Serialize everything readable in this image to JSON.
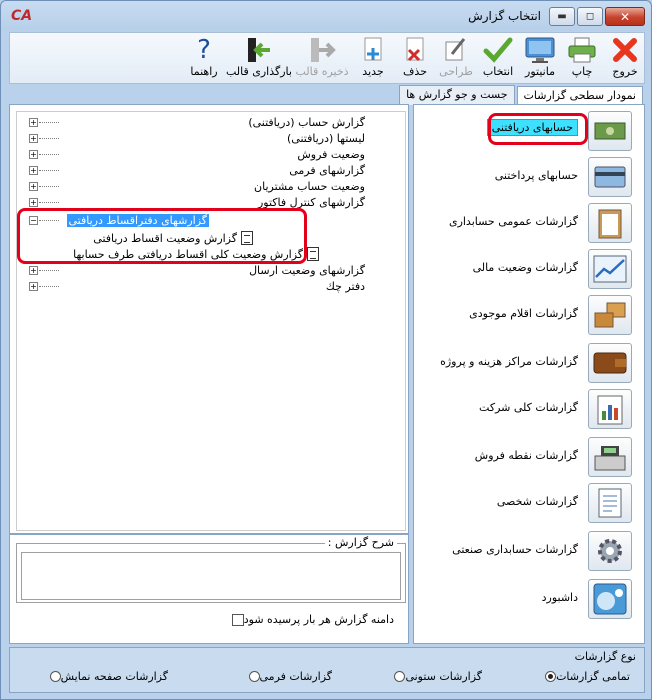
{
  "window": {
    "title": "انتخاب گزارش",
    "logo": "CA",
    "min_glyph": "▬",
    "max_glyph": "◻",
    "close_glyph": "✕",
    "colors": {
      "title_bg": "#b9d1ea",
      "selection": "#3399ff",
      "highlight": "#3de0ff",
      "callout": "#e3001b"
    }
  },
  "toolbar": {
    "exit": "خروج",
    "print": "چاپ",
    "monitor": "مانیتور",
    "select": "انتخاب",
    "design": "طراحی",
    "delete": "حذف",
    "new": "جدید",
    "save_template": "ذخیره قالب",
    "load_template": "بارگذاری قالب",
    "help": "راهنما"
  },
  "tabs": [
    "نمودار سطحی گزارشات",
    "جست و جو گزارش ها"
  ],
  "tree": {
    "nodes": [
      "گزارش حساب (دریافتنی)",
      "لیستها (دریافتنی)",
      "وضعیت فروش",
      "گزارشهای فرمی",
      "وضعیت حساب مشتریان",
      "گزارشهای کنترل فاکتور",
      "گزارشهای دفتراقساط دریافتی",
      "گزارشهای وضعیت ارسال",
      "دفتر چك"
    ],
    "expander_plus": "+",
    "expander_minus": "−",
    "selected_children": [
      "گزارش وضعیت اقساط دریافتی",
      "گزارش وضعیت کلی اقساط دریافتی طرف حسابها"
    ]
  },
  "description": {
    "legend": "شرح گزارش :",
    "checkbox_label": "دامنه گزارش هر بار پرسیده شود"
  },
  "categories": [
    {
      "label": "حسابهای دریافتنی",
      "icon": "cash-icon"
    },
    {
      "label": "حسابهای پرداختنی",
      "icon": "credit-card-icon"
    },
    {
      "label": "گزارشات عمومی حسابداری",
      "icon": "clipboard-icon"
    },
    {
      "label": "گزارشات وضعیت مالی",
      "icon": "line-chart-icon"
    },
    {
      "label": "گزارشات اقلام موجودی",
      "icon": "boxes-icon"
    },
    {
      "label": "گزارشات مراکز هزینه و پروژه",
      "icon": "wallet-icon"
    },
    {
      "label": "گزارشات کلی شرکت",
      "icon": "bar-report-icon"
    },
    {
      "label": "گزارشات نقطه فروش",
      "icon": "cash-register-icon"
    },
    {
      "label": "گزارشات شخصی",
      "icon": "document-icon"
    },
    {
      "label": "گزارشات حسابداری صنعتی",
      "icon": "gear-icon"
    },
    {
      "label": "داشبورد",
      "icon": "dashboard-icon"
    }
  ],
  "report_type": {
    "legend": "نوع گزارشات",
    "options": [
      "تمامی گزارشات",
      "گزارشات ستونی",
      "گزارشات فرمی",
      "گزارشات صفحه نمایش"
    ],
    "selected": "تمامی گزارشات"
  }
}
